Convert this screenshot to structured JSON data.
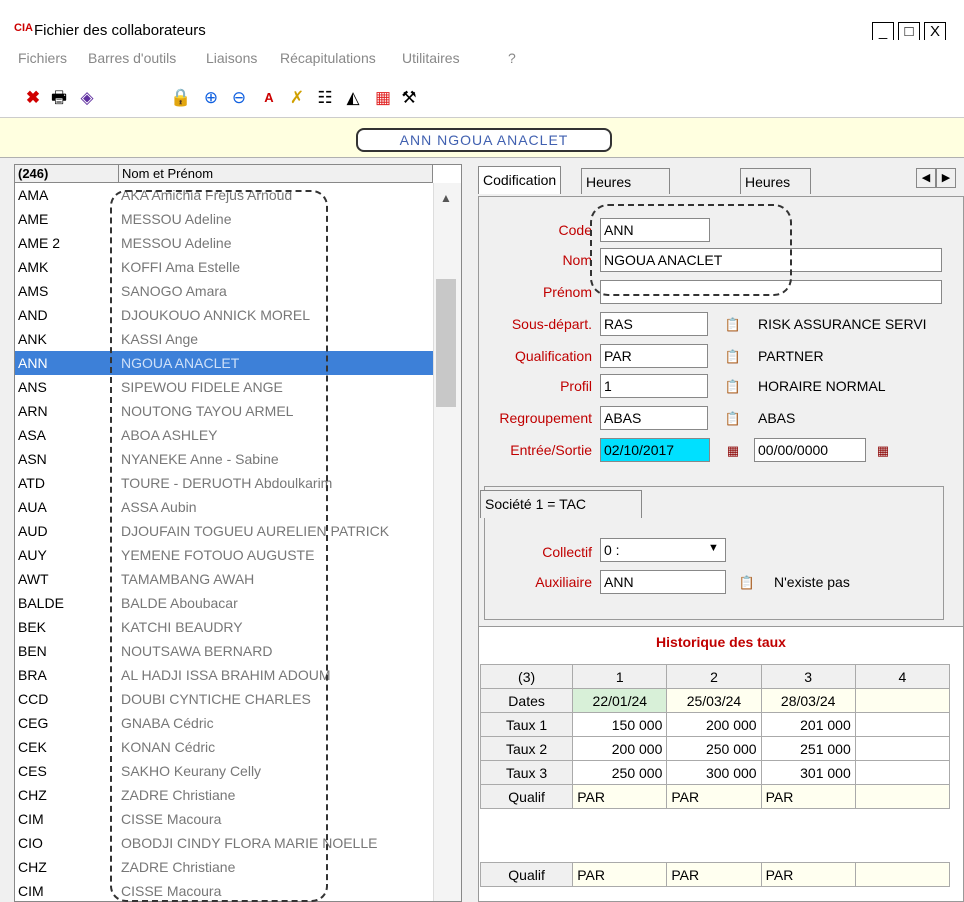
{
  "window": {
    "logo": "CIA",
    "title": "Fichier des collaborateurs",
    "controls": [
      "_",
      "□",
      "X"
    ]
  },
  "menu": [
    "Fichiers",
    "Barres d'outils",
    "Liaisons",
    "Récapitulations",
    "Utilitaires",
    "?"
  ],
  "toolbar_icons": [
    "close-red-x-icon",
    "print-icon",
    "book-icon",
    "lock-icon",
    "add-circle-icon",
    "remove-circle-icon",
    "font-icon",
    "cross-colors-icon",
    "tree-icon",
    "stack-icon",
    "grid-color-icon",
    "tools-icon"
  ],
  "banner": {
    "text": "ANN NGOUA ANACLET"
  },
  "list": {
    "count_header": "(246)",
    "name_header": "Nom et Prénom",
    "rows": [
      {
        "code": "AMA",
        "nom": "AKA Amichia Frejus Arnoud"
      },
      {
        "code": "AME",
        "nom": "MESSOU Adeline"
      },
      {
        "code": "AME 2",
        "nom": "MESSOU Adeline"
      },
      {
        "code": "AMK",
        "nom": "KOFFI Ama Estelle"
      },
      {
        "code": "AMS",
        "nom": "SANOGO Amara"
      },
      {
        "code": "AND",
        "nom": "DJOUKOUO ANNICK MOREL"
      },
      {
        "code": "ANK",
        "nom": "KASSI Ange"
      },
      {
        "code": "ANN",
        "nom": "NGOUA ANACLET"
      },
      {
        "code": "ANS",
        "nom": "SIPEWOU FIDELE ANGE"
      },
      {
        "code": "ARN",
        "nom": "NOUTONG TAYOU ARMEL"
      },
      {
        "code": "ASA",
        "nom": "ABOA ASHLEY"
      },
      {
        "code": "ASN",
        "nom": "NYANEKE Anne - Sabine"
      },
      {
        "code": "ATD",
        "nom": "TOURE - DERUOTH Abdoulkarim"
      },
      {
        "code": "AUA",
        "nom": "ASSA Aubin"
      },
      {
        "code": "AUD",
        "nom": "DJOUFAIN TOGUEU AURELIEN PATRICK"
      },
      {
        "code": "AUY",
        "nom": "YEMENE FOTOUO AUGUSTE"
      },
      {
        "code": "AWT",
        "nom": "TAMAMBANG AWAH"
      },
      {
        "code": "BALDE",
        "nom": "BALDE Aboubacar"
      },
      {
        "code": "BEK",
        "nom": "KATCHI BEAUDRY"
      },
      {
        "code": "BEN",
        "nom": "NOUTSAWA BERNARD"
      },
      {
        "code": "BRA",
        "nom": "AL HADJI ISSA BRAHIM ADOUM"
      },
      {
        "code": "CCD",
        "nom": "DOUBI CYNTICHE CHARLES"
      },
      {
        "code": "CEG",
        "nom": "GNABA Cédric"
      },
      {
        "code": "CEK",
        "nom": "KONAN Cédric"
      },
      {
        "code": "CES",
        "nom": "SAKHO Keurany Celly"
      },
      {
        "code": "CHZ",
        "nom": "ZADRE Christiane"
      },
      {
        "code": "CIM",
        "nom": "CISSE Macoura"
      },
      {
        "code": "CIO",
        "nom": "OBODJI CINDY FLORA MARIE NOELLE"
      },
      {
        "code": "CHZ",
        "nom": "ZADRE Christiane"
      },
      {
        "code": "CIM",
        "nom": "CISSE Macoura"
      }
    ]
  },
  "tabs": [
    "Codification",
    "Heures Chargeables",
    "Heures non chargeabl"
  ],
  "form": {
    "code_label": "Code",
    "code_value": "ANN",
    "nom_label": "Nom",
    "nom_value": "NGOUA ANACLET",
    "prenom_label": "Prénom",
    "prenom_value": "",
    "sousdep_label": "Sous-départ.",
    "sousdep_value": "RAS",
    "sousdep_desc": "RISK ASSURANCE SERVI",
    "qualif_label": "Qualification",
    "qualif_value": "PAR",
    "qualif_desc": "PARTNER",
    "profil_label": "Profil",
    "profil_value": "1",
    "profil_desc": "HORAIRE NORMAL",
    "regroup_label": "Regroupement",
    "regroup_value": "ABAS",
    "regroup_desc": "ABAS",
    "entree_label": "Entrée/Sortie",
    "entree_value": "02/10/2017",
    "sortie_value": "00/00/0000"
  },
  "societe": {
    "tab_label": "Société 1 = TAC",
    "collectif_label": "Collectif",
    "collectif_value": "0 :",
    "auxiliaire_label": "Auxiliaire",
    "auxiliaire_value": "ANN",
    "auxiliaire_desc": "N'existe pas"
  },
  "historique": {
    "title": "Historique des taux",
    "header": [
      "(3)",
      "1",
      "2",
      "3",
      "4"
    ],
    "rows": [
      {
        "label": "Dates",
        "values": [
          "22/01/24",
          "25/03/24",
          "28/03/24",
          ""
        ]
      },
      {
        "label": "Taux 1",
        "values": [
          "150 000",
          "200 000",
          "201 000",
          ""
        ]
      },
      {
        "label": "Taux 2",
        "values": [
          "200 000",
          "250 000",
          "251 000",
          ""
        ]
      },
      {
        "label": "Taux 3",
        "values": [
          "250 000",
          "300 000",
          "301 000",
          ""
        ]
      },
      {
        "label": "Qualif",
        "values": [
          "PAR",
          "PAR",
          "PAR",
          ""
        ]
      }
    ],
    "extra_row": {
      "label": "Qualif",
      "values": [
        "PAR",
        "PAR",
        "PAR",
        ""
      ]
    }
  },
  "colors": {
    "selected": "#3d80d8",
    "label_red": "#c00000",
    "highlight_cyan": "#00e0ff",
    "banner_bg": "#ffffe0",
    "date_green": "#d8f0d8"
  }
}
